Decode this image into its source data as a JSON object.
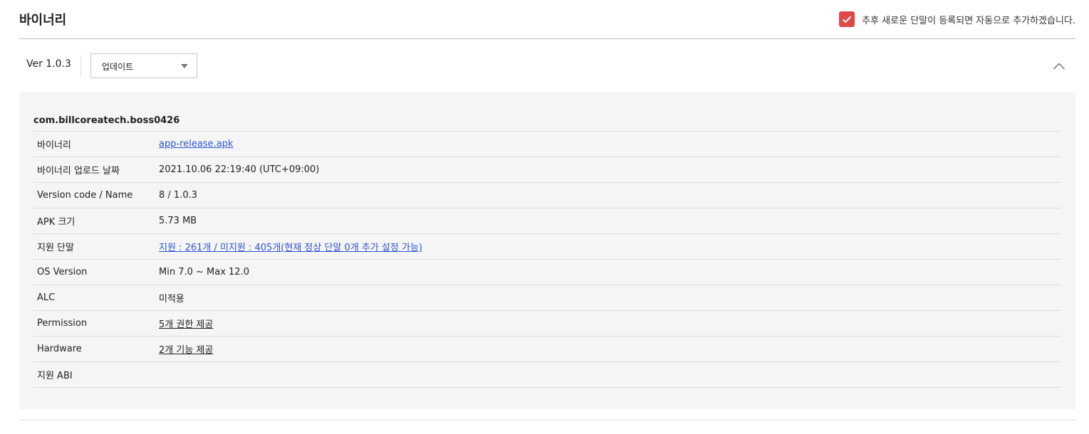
{
  "header": {
    "title": "바이너리",
    "auto_add_checked": true,
    "auto_add_label": "추후 새로운 단말이 등록되면 자동으로 추가하겠습니다.",
    "accent_color": "#e04848"
  },
  "version": {
    "label": "Ver 1.0.3",
    "select_value": "업데이트",
    "collapse_icon": "chevron-up-icon"
  },
  "details": {
    "package_name": "com.billcoreatech.boss0426",
    "rows": [
      {
        "label": "바이너리",
        "value": "app-release.apk"
      },
      {
        "label": "바이너리 업로드 날짜",
        "value": "2021.10.06 22:19:40 (UTC+09:00)"
      },
      {
        "label": "Version code / Name",
        "value": "8 / 1.0.3"
      },
      {
        "label": "APK 크기",
        "value": "5.73 MB"
      },
      {
        "label": "지원 단말",
        "value": "지원 : 261개 / 미지원 : 405개(현재 정상 단말 0개 추가 설정 가능)"
      },
      {
        "label": "OS Version",
        "value": "Min 7.0 ~ Max 12.0"
      },
      {
        "label": "ALC",
        "value": "미적용"
      },
      {
        "label": "Permission",
        "value": "5개 권한 제공"
      },
      {
        "label": "Hardware",
        "value": "2개 기능 제공"
      },
      {
        "label": "지원 ABI",
        "value": ""
      }
    ]
  }
}
